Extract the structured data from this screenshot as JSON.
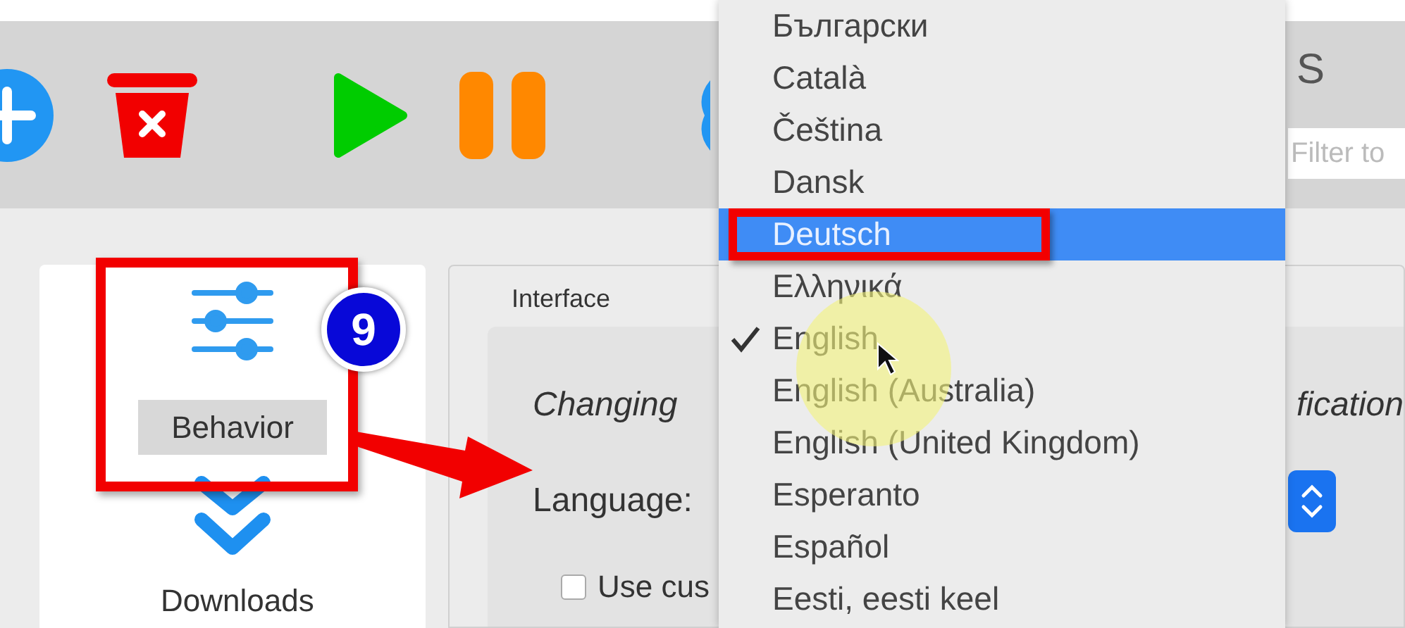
{
  "toolbar": {
    "tab_fragment": "S",
    "filter_field": {
      "placeholder": "Filter to"
    }
  },
  "sidebar": {
    "items": [
      {
        "label": "Behavior",
        "selected": true,
        "kind": "sliders"
      },
      {
        "label": "Downloads",
        "selected": false,
        "kind": "chevrons"
      }
    ]
  },
  "content": {
    "section_title": "Interface",
    "notice_start": "Changing",
    "notice_end": "fication",
    "language_label": "Language:",
    "custom_checkbox": {
      "label": "Use cus",
      "checked": false
    }
  },
  "language_menu": {
    "items": [
      {
        "label": "Български",
        "selected": false,
        "checked": false
      },
      {
        "label": "Català",
        "selected": false,
        "checked": false
      },
      {
        "label": "Čeština",
        "selected": false,
        "checked": false
      },
      {
        "label": "Dansk",
        "selected": false,
        "checked": false
      },
      {
        "label": "Deutsch",
        "selected": true,
        "checked": false
      },
      {
        "label": "Ελληνικά",
        "selected": false,
        "checked": false
      },
      {
        "label": "English",
        "selected": false,
        "checked": true
      },
      {
        "label": "English (Australia)",
        "selected": false,
        "checked": false
      },
      {
        "label": "English (United Kingdom)",
        "selected": false,
        "checked": false
      },
      {
        "label": "Esperanto",
        "selected": false,
        "checked": false
      },
      {
        "label": "Español",
        "selected": false,
        "checked": false
      },
      {
        "label": "Eesti, eesti keel",
        "selected": false,
        "checked": false
      }
    ]
  },
  "annotation": {
    "step": "9"
  }
}
